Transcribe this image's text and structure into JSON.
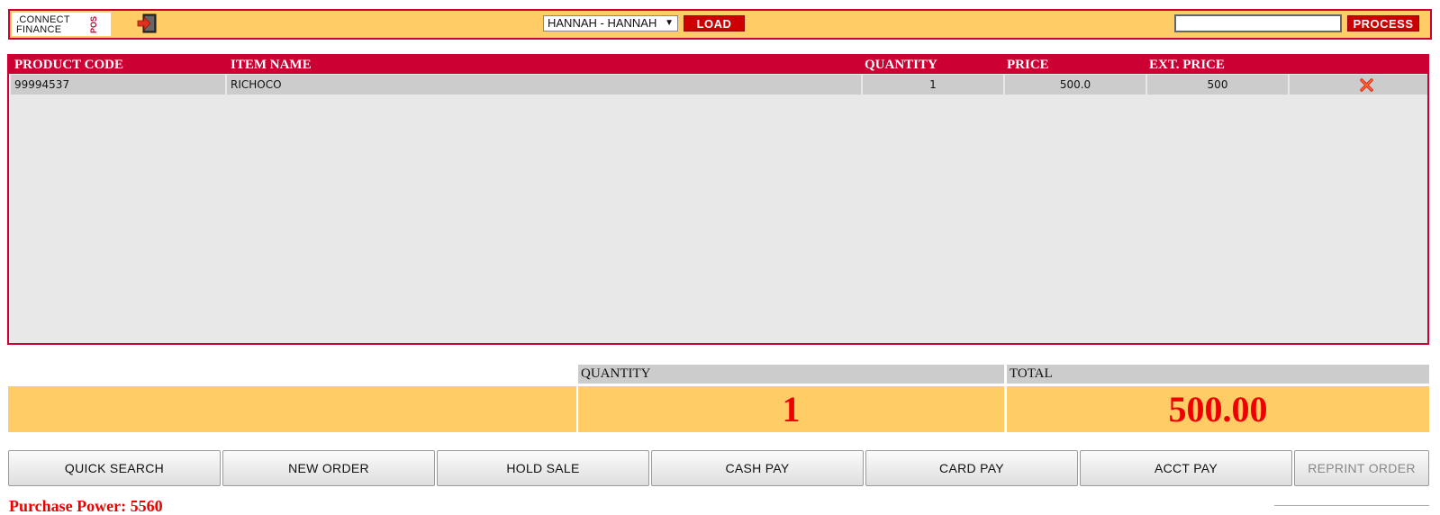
{
  "brand": {
    "line1": ".CONNECT",
    "line2": "FINANCE",
    "tag": "POS"
  },
  "topbar": {
    "user_selected": "HANNAH - HANNAH",
    "load_label": "LOAD",
    "process_label": "PROCESS",
    "search_value": ""
  },
  "table": {
    "headers": [
      "PRODUCT CODE",
      "ITEM NAME",
      "QUANTITY",
      "PRICE",
      "EXT. PRICE"
    ],
    "rows": [
      {
        "code": "99994537",
        "name": "RICHOCO",
        "quantity": "1",
        "price": "500.0",
        "ext_price": "500"
      }
    ]
  },
  "totals": {
    "quantity_label": "QUANTITY",
    "total_label": "TOTAL",
    "quantity_value": "1",
    "total_value": "500.00"
  },
  "actions": [
    {
      "label": "QUICK SEARCH",
      "enabled": true
    },
    {
      "label": "NEW ORDER",
      "enabled": true
    },
    {
      "label": "HOLD SALE",
      "enabled": true
    },
    {
      "label": "CASH PAY",
      "enabled": true
    },
    {
      "label": "CARD PAY",
      "enabled": true
    },
    {
      "label": "ACCT PAY",
      "enabled": true
    },
    {
      "label": "REPRINT ORDER",
      "enabled": false
    }
  ],
  "purchase_power": "Purchase Power: 5560",
  "icons": {
    "exit": "exit-icon",
    "delete": "delete-icon"
  },
  "colors": {
    "accent": "#cc0033",
    "panel": "#ffcc66",
    "value_red": "#ee0000"
  }
}
